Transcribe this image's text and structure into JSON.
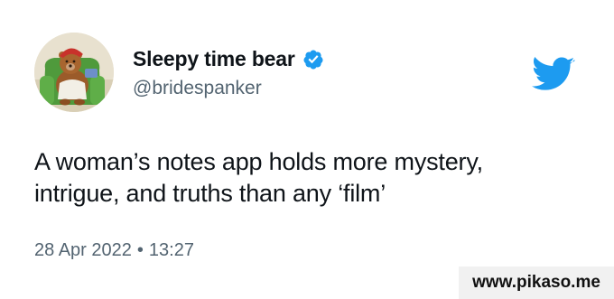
{
  "tweet": {
    "display_name": "Sleepy time bear",
    "handle": "@bridespanker",
    "text_lines": [
      "A woman’s notes app holds more mystery,",
      "intrigue, and truths than any ‘film’"
    ],
    "date": "28 Apr 2022",
    "separator": "•",
    "time": "13:27",
    "avatar_icon": "bear-in-armchair-avatar",
    "verified_icon": "verified-badge-icon",
    "logo_icon": "twitter-bird-icon"
  },
  "watermark": {
    "text": "www.pikaso.me"
  },
  "colors": {
    "name": "#0f1419",
    "secondary": "#536471",
    "twitter_blue": "#1d9bf0",
    "watermark_bg": "#f1f1f1"
  }
}
